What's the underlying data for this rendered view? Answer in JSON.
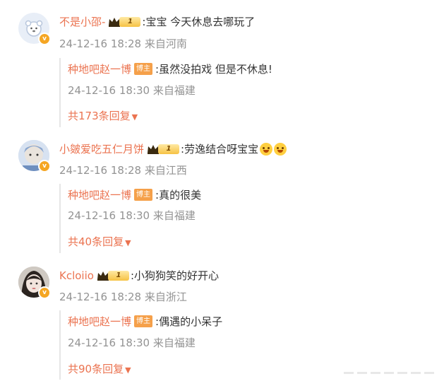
{
  "comments": [
    {
      "username": "不是小邵-",
      "level": "1",
      "text": ":宝宝 今天休息去哪玩了",
      "meta": "24-12-16 18:28 来自河南",
      "avatar_color": "#dfe9f7",
      "reply": {
        "username": "种地吧赵一博",
        "badge": "博主",
        "text": ":虽然没拍戏 但是不休息!",
        "meta": "24-12-16 18:30 来自福建"
      },
      "more_replies": "共173条回复"
    },
    {
      "username": "小皴爱吃五仁月饼",
      "level": "1",
      "text": ":劳逸结合呀宝宝",
      "meta": "24-12-16 18:28 来自江西",
      "avatar_color": "#c9d6ea",
      "reply": {
        "username": "种地吧赵一博",
        "badge": "博主",
        "text": ":真的很美",
        "meta": "24-12-16 18:30 来自福建"
      },
      "more_replies": "共40条回复"
    },
    {
      "username": "Kcloiio",
      "level": "1",
      "text": ":小狗狗笑的好开心",
      "meta": "24-12-16 18:28 来自浙江",
      "avatar_color": "#b9b3ad",
      "reply": {
        "username": "种地吧赵一博",
        "badge": "博主",
        "text": ":偶遇的小呆子",
        "meta": "24-12-16 18:30 来自福建"
      },
      "more_replies": "共90条回复"
    }
  ],
  "colors": {
    "username": "#eb7350",
    "meta": "#939393",
    "vip_badge": "#f5a623"
  },
  "verified_mark": "v"
}
